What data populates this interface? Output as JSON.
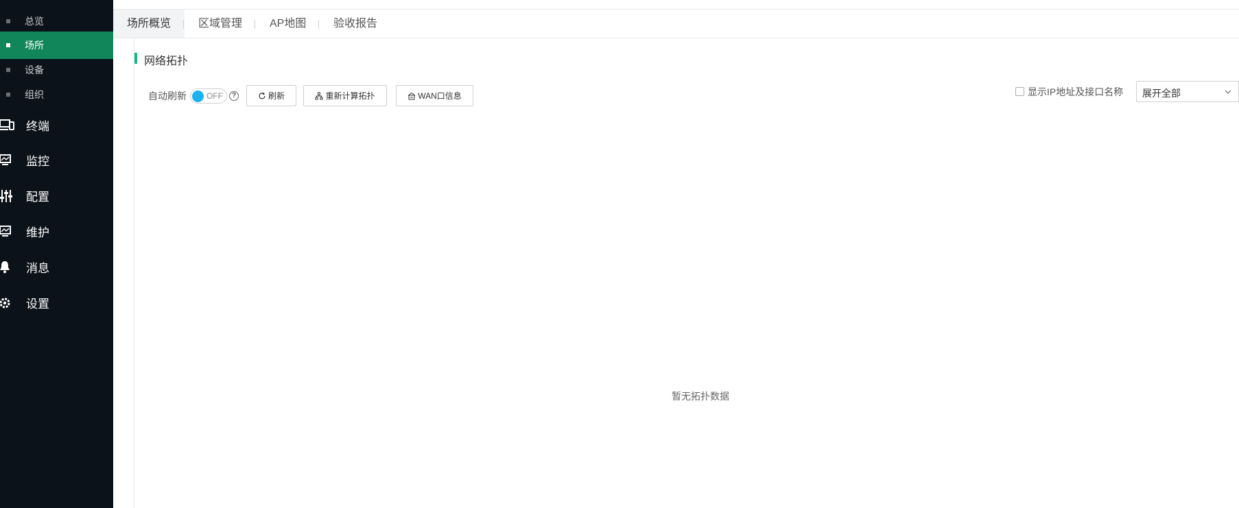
{
  "sidebar": {
    "sub_items": [
      {
        "label": "总览"
      },
      {
        "label": "场所"
      },
      {
        "label": "设备"
      },
      {
        "label": "组织"
      }
    ],
    "main_items": [
      {
        "label": "终端",
        "icon": "terminal-icon"
      },
      {
        "label": "监控",
        "icon": "monitor-icon"
      },
      {
        "label": "配置",
        "icon": "sliders-icon"
      },
      {
        "label": "维护",
        "icon": "maintenance-icon"
      },
      {
        "label": "消息",
        "icon": "bell-icon"
      },
      {
        "label": "设置",
        "icon": "gear-icon"
      }
    ],
    "active_sub": "场所",
    "accent": "#10865a"
  },
  "tabs": [
    {
      "label": "场所概览"
    },
    {
      "label": "区域管理"
    },
    {
      "label": "AP地图"
    },
    {
      "label": "验收报告"
    }
  ],
  "section": {
    "title": "网络拓扑"
  },
  "toolbar": {
    "auto_refresh_label": "自动刷新",
    "toggle_state": "OFF",
    "help_symbol": "?",
    "refresh_label": "刷新",
    "recalc_label": "重新计算拓扑",
    "wan_label": "WAN口信息",
    "show_ip_label": "显示IP地址及接口名称",
    "show_ip_checked": false,
    "expand_value": "展开全部"
  },
  "empty_state": "暂无拓扑数据"
}
